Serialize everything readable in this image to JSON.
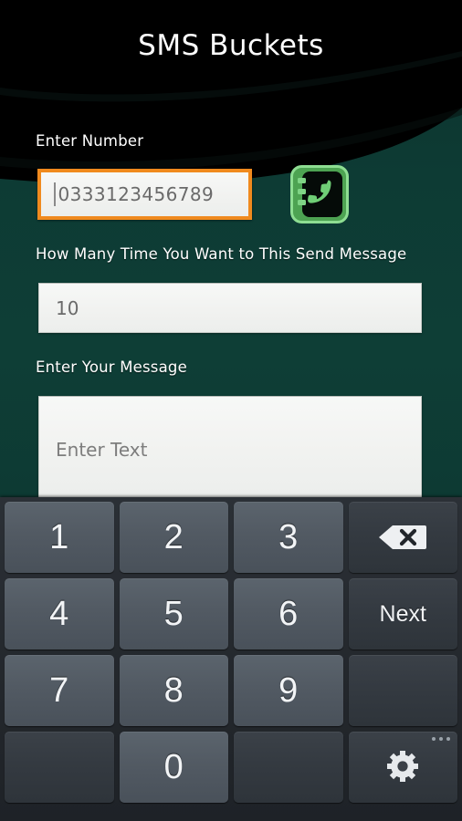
{
  "app": {
    "title": "SMS Buckets",
    "background_teal": "#0d3b34",
    "background_black": "#000000",
    "accent_orange": "#f08a1e",
    "accent_green": "#6cc070"
  },
  "form": {
    "number": {
      "label": "Enter Number",
      "value": "0333123456789",
      "focused": true,
      "border_color": "#f08a1e"
    },
    "contact_picker": {
      "icon": "contacts-phonebook-icon",
      "color": "#6cc070"
    },
    "times": {
      "label": "How Many Time You Want to This Send Message",
      "value": "10"
    },
    "message": {
      "label": "Enter Your Message",
      "placeholder": "Enter Text",
      "value": ""
    }
  },
  "keyboard": {
    "type": "numeric",
    "rows": [
      [
        {
          "label": "1",
          "kind": "num",
          "name": "key-1"
        },
        {
          "label": "2",
          "kind": "num",
          "name": "key-2"
        },
        {
          "label": "3",
          "kind": "num",
          "name": "key-3"
        },
        {
          "label": "",
          "kind": "fn",
          "name": "key-backspace",
          "icon": "backspace-icon"
        }
      ],
      [
        {
          "label": "4",
          "kind": "num",
          "name": "key-4"
        },
        {
          "label": "5",
          "kind": "num",
          "name": "key-5"
        },
        {
          "label": "6",
          "kind": "num",
          "name": "key-6"
        },
        {
          "label": "Next",
          "kind": "fn",
          "name": "key-next"
        }
      ],
      [
        {
          "label": "7",
          "kind": "num",
          "name": "key-7"
        },
        {
          "label": "8",
          "kind": "num",
          "name": "key-8"
        },
        {
          "label": "9",
          "kind": "num",
          "name": "key-9"
        },
        {
          "label": "",
          "kind": "fn",
          "name": "key-blank-top-right"
        }
      ],
      [
        {
          "label": "",
          "kind": "fn",
          "name": "key-blank-bottom-left"
        },
        {
          "label": "0",
          "kind": "num",
          "name": "key-0"
        },
        {
          "label": "",
          "kind": "fn",
          "name": "key-blank-bottom-mid"
        },
        {
          "label": "",
          "kind": "fn",
          "name": "key-settings",
          "icon": "gear-icon"
        }
      ]
    ]
  }
}
